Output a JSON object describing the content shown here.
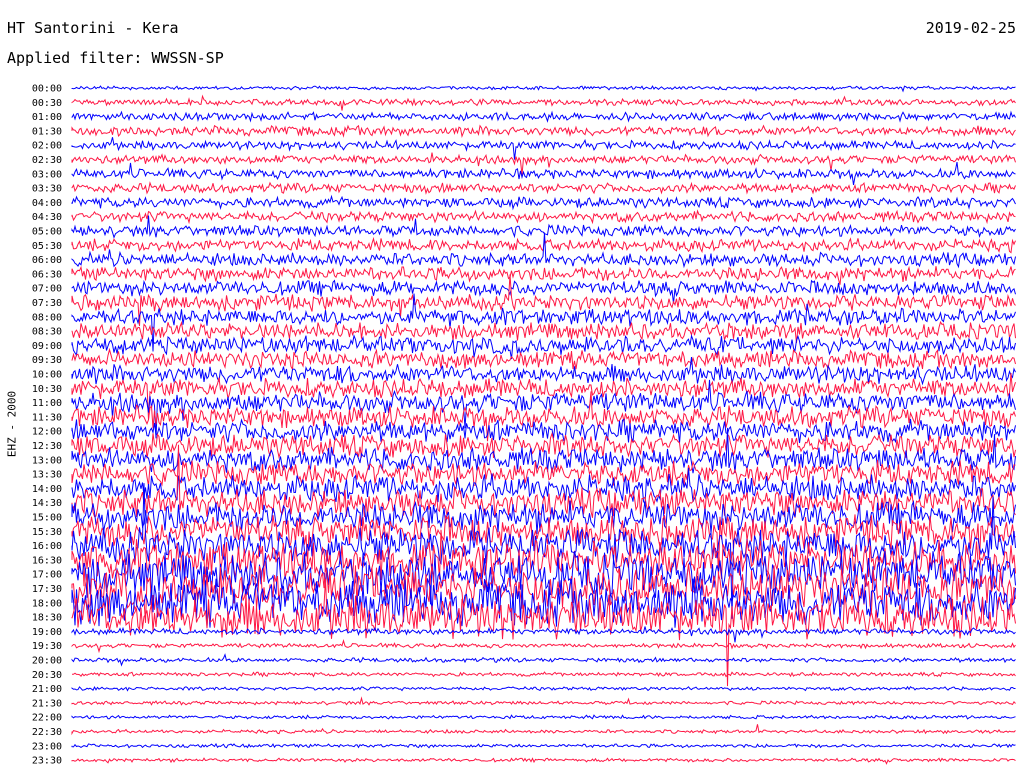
{
  "header": {
    "station": "HT Santorini - Kera",
    "date": "2019-02-25",
    "filter": "Applied filter: WWSSN-SP"
  },
  "chart_data": {
    "type": "line",
    "title": "HT Santorini - Kera",
    "ylabel": "EHZ - 2000",
    "y_tick_labels": [
      "00:00",
      "00:30",
      "01:00",
      "01:30",
      "02:00",
      "02:30",
      "03:00",
      "03:30",
      "04:00",
      "04:30",
      "05:00",
      "05:30",
      "06:00",
      "06:30",
      "07:00",
      "07:30",
      "08:00",
      "08:30",
      "09:00",
      "09:30",
      "10:00",
      "10:30",
      "11:00",
      "11:30",
      "12:00",
      "12:30",
      "13:00",
      "13:30",
      "14:00",
      "14:30",
      "15:00",
      "15:30",
      "16:00",
      "16:30",
      "17:00",
      "17:30",
      "18:00",
      "18:30",
      "19:00",
      "19:30",
      "20:00",
      "20:30",
      "21:00",
      "21:30",
      "22:00",
      "22:30",
      "23:00",
      "23:30"
    ],
    "trace_colors": [
      "#0000ff",
      "#ff1744"
    ],
    "relative_amplitude": [
      0.2,
      0.35,
      0.45,
      0.55,
      0.5,
      0.5,
      0.55,
      0.55,
      0.6,
      0.6,
      0.65,
      0.7,
      0.75,
      0.8,
      0.85,
      0.9,
      0.95,
      0.95,
      1.0,
      1.0,
      1.05,
      1.1,
      1.15,
      1.2,
      1.25,
      1.3,
      1.35,
      1.4,
      1.5,
      1.6,
      1.7,
      1.8,
      2.0,
      2.2,
      2.4,
      2.5,
      2.6,
      2.4,
      0.35,
      0.25,
      0.25,
      0.22,
      0.2,
      0.2,
      0.2,
      0.2,
      0.2,
      0.2
    ],
    "grid": false
  }
}
